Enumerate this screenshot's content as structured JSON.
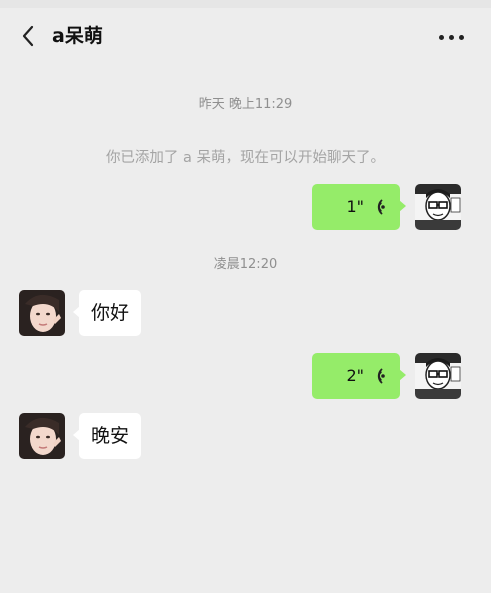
{
  "header": {
    "back_icon": "chevron-left-icon",
    "title": "a呆萌",
    "more_icon": "more-horizontal-icon"
  },
  "chat": {
    "timestamps": [
      "昨天 晚上11:29",
      "凌晨12:20"
    ],
    "system_message": "你已添加了 a 呆萌，现在可以开始聊天了。",
    "messages": [
      {
        "side": "right",
        "type": "voice",
        "duration": "1\"",
        "icon": "voice-wave-icon"
      },
      {
        "side": "left",
        "type": "text",
        "text": "你好"
      },
      {
        "side": "right",
        "type": "voice",
        "duration": "2\"",
        "icon": "voice-wave-icon"
      },
      {
        "side": "left",
        "type": "text",
        "text": "晚安"
      }
    ]
  },
  "colors": {
    "background": "#ededed",
    "bubble_self": "#95ec69",
    "bubble_other": "#ffffff",
    "muted_text": "#8f8f8f"
  }
}
